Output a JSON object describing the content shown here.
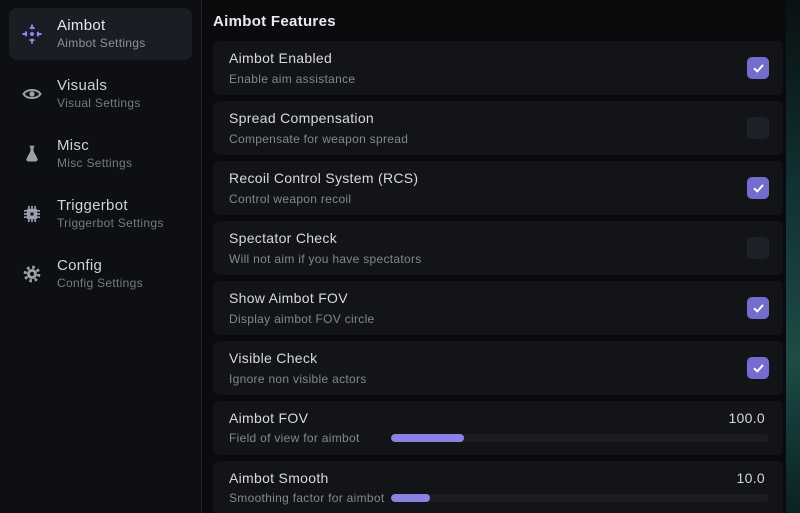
{
  "colors": {
    "accent": "#746dce",
    "slider-fill": "#8a83e4",
    "page-bg": "#0a0b0d",
    "sidebar-bg": "#0e0f12",
    "card-bg": "#131418",
    "active-bg": "#1b1d24",
    "unchecked-bg": "#1f2128",
    "track-bg": "#1b1c22"
  },
  "sidebar": {
    "items": [
      {
        "label": "Aimbot",
        "sublabel": "Aimbot Settings",
        "icon": "crosshair-icon",
        "active": true
      },
      {
        "label": "Visuals",
        "sublabel": "Visual Settings",
        "icon": "eye-icon",
        "active": false
      },
      {
        "label": "Misc",
        "sublabel": "Misc Settings",
        "icon": "flask-icon",
        "active": false
      },
      {
        "label": "Triggerbot",
        "sublabel": "Triggerbot Settings",
        "icon": "chip-icon",
        "active": false
      },
      {
        "label": "Config",
        "sublabel": "Config Settings",
        "icon": "gear-icon",
        "active": false
      }
    ]
  },
  "main": {
    "header": "Aimbot Features",
    "toggles": [
      {
        "label": "Aimbot Enabled",
        "description": "Enable aim assistance",
        "checked": true
      },
      {
        "label": "Spread Compensation",
        "description": "Compensate for weapon spread",
        "checked": false
      },
      {
        "label": "Recoil Control System (RCS)",
        "description": "Control weapon recoil",
        "checked": true
      },
      {
        "label": "Spectator Check",
        "description": "Will not aim if you have spectators",
        "checked": false
      },
      {
        "label": "Show Aimbot FOV",
        "description": "Display aimbot FOV circle",
        "checked": true
      },
      {
        "label": "Visible Check",
        "description": "Ignore non visible actors",
        "checked": true
      }
    ],
    "sliders": [
      {
        "label": "Aimbot FOV",
        "description": "Field of view for aimbot",
        "value": "100.0",
        "percent": 19.3
      },
      {
        "label": "Aimbot Smooth",
        "description": "Smoothing factor for aimbot",
        "value": "10.0",
        "percent": 10.3
      }
    ]
  }
}
